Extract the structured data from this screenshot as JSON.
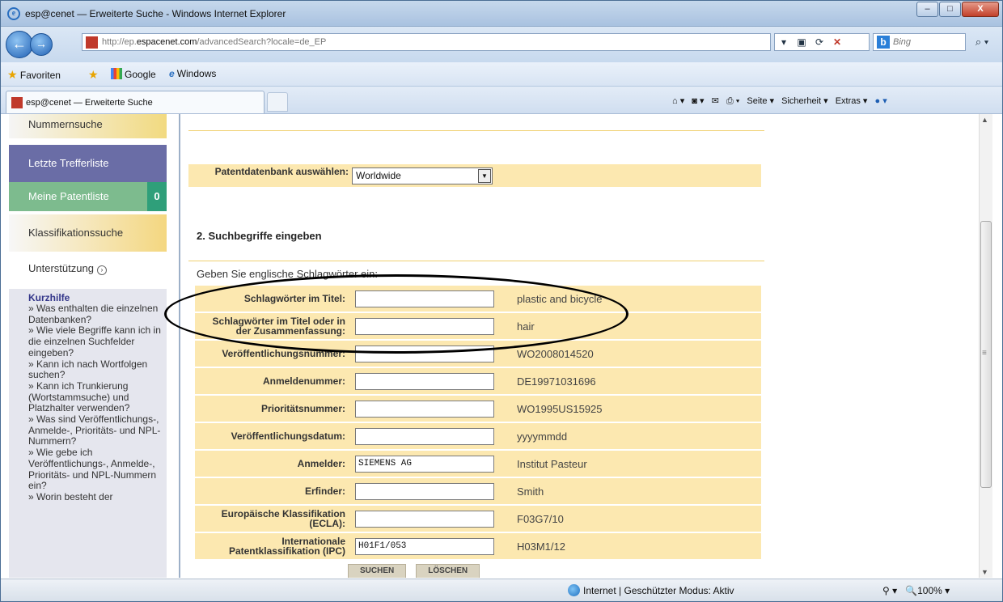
{
  "window": {
    "title": "esp@cenet — Erweiterte Suche - Windows Internet Explorer"
  },
  "address": {
    "url_prefix": "http://ep.",
    "url_domain": "espacenet.com",
    "url_path": "/advancedSearch?locale=de_EP"
  },
  "search": {
    "placeholder": "Bing"
  },
  "favorites": {
    "label": "Favoriten",
    "items": [
      "Google",
      "Windows"
    ]
  },
  "tab": {
    "label": "esp@cenet — Erweiterte Suche"
  },
  "commands": {
    "seite": "Seite ▾",
    "sicherheit": "Sicherheit ▾",
    "extras": "Extras ▾"
  },
  "sidebar": {
    "items": [
      {
        "label": "Nummernsuche"
      },
      {
        "label": "Letzte Trefferliste"
      },
      {
        "label": "Meine Patentliste",
        "count": "0"
      },
      {
        "label": "Klassifikationssuche"
      },
      {
        "label": "Unterstützung"
      }
    ],
    "help_title": "Kurzhilfe",
    "help_items": [
      "» Was enthalten die einzelnen Datenbanken?",
      "» Wie viele Begriffe kann ich in die einzelnen Suchfelder eingeben?",
      "» Kann ich nach Wortfolgen suchen?",
      "» Kann ich Trunkierung (Wortstammsuche) und Platzhalter verwenden?",
      "» Was sind Veröffentlichungs-, Anmelde-, Prioritäts- und NPL-Nummern?",
      "» Wie gebe ich Veröffentlichungs-, Anmelde-, Prioritäts- und NPL-Nummern ein?",
      "» Worin besteht der"
    ]
  },
  "main": {
    "db_label": "Patentdatenbank auswählen:",
    "db_value": "Worldwide",
    "section_title": "2. Suchbegriffe eingeben",
    "instruction": "Geben Sie englische Schlagwörter ein:",
    "fields": [
      {
        "label": "Schlagwörter im Titel:",
        "value": "",
        "example": "plastic and bicycle"
      },
      {
        "label": "Schlagwörter im Titel oder in der Zusammenfassung:",
        "value": "",
        "example": "hair"
      },
      {
        "label": "Veröffentlichungsnummer:",
        "value": "",
        "example": "WO2008014520"
      },
      {
        "label": "Anmeldenummer:",
        "value": "",
        "example": "DE19971031696"
      },
      {
        "label": "Prioritätsnummer:",
        "value": "",
        "example": "WO1995US15925"
      },
      {
        "label": "Veröffentlichungsdatum:",
        "value": "",
        "example": "yyyymmdd"
      },
      {
        "label": "Anmelder:",
        "value": "SIEMENS AG",
        "example": "Institut Pasteur"
      },
      {
        "label": "Erfinder:",
        "value": "",
        "example": "Smith"
      },
      {
        "label": "Europäische Klassifikation (ECLA):",
        "value": "",
        "example": "F03G7/10"
      },
      {
        "label": "Internationale Patentklassifikation (IPC)",
        "value": "H01F1/053",
        "example": "H03M1/12"
      }
    ],
    "buttons": {
      "search": "SUCHEN",
      "clear": "LÖSCHEN"
    }
  },
  "status": {
    "zone": "Internet | Geschützter Modus: Aktiv",
    "zoom": "100%"
  }
}
